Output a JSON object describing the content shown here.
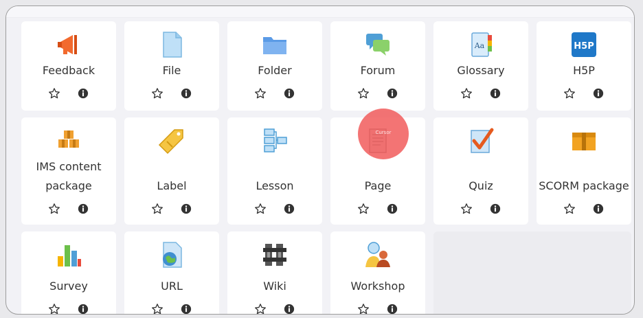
{
  "tiles": [
    {
      "label": "Feedback"
    },
    {
      "label": "File"
    },
    {
      "label": "Folder"
    },
    {
      "label": "Forum"
    },
    {
      "label": "Glossary"
    },
    {
      "label": "H5P",
      "icon_text": "H5P"
    },
    {
      "label_line1": "IMS content",
      "label_line2": "package"
    },
    {
      "label": "Label"
    },
    {
      "label": "Lesson"
    },
    {
      "label": "Page"
    },
    {
      "label": "Quiz"
    },
    {
      "label": "SCORM package"
    },
    {
      "label": "Survey"
    },
    {
      "label": "URL"
    },
    {
      "label": "Wiki"
    },
    {
      "label": "Workshop"
    }
  ],
  "glossary_icon_text": "Aa",
  "cursor_text": "Cursor",
  "colors": {
    "accent": "#f05555",
    "tile_bg": "#ffffff",
    "page_bg": "#f2f2f6",
    "text": "#333333"
  }
}
